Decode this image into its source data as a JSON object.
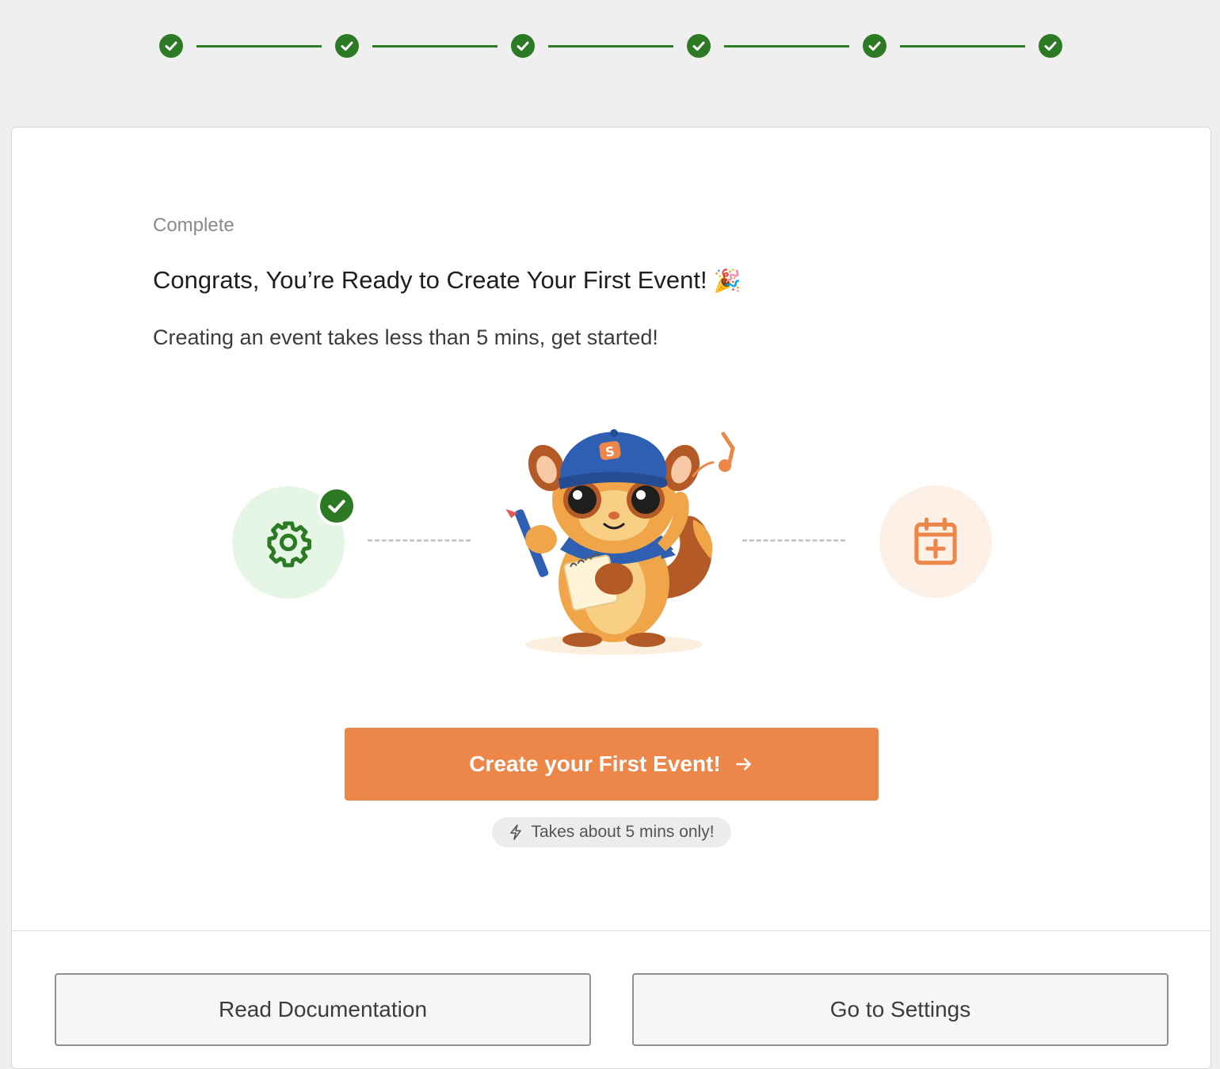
{
  "stepper": {
    "steps": [
      {
        "status": "complete",
        "icon": "check-icon"
      },
      {
        "status": "complete",
        "icon": "check-icon"
      },
      {
        "status": "complete",
        "icon": "check-icon"
      },
      {
        "status": "complete",
        "icon": "check-icon"
      },
      {
        "status": "complete",
        "icon": "check-icon"
      },
      {
        "status": "complete",
        "icon": "check-icon"
      }
    ],
    "color": "#2d7a24"
  },
  "card": {
    "eyebrow": "Complete",
    "headline": "Congrats, You’re Ready to Create Your First Event!",
    "headline_emoji": "🎉",
    "subtitle": "Creating an event takes less than 5 mins, get started!"
  },
  "illustration": {
    "left_icon": "gear-icon",
    "left_badge": "check-icon",
    "center": "mascot-illustration",
    "right_icon": "calendar-plus-icon",
    "colors": {
      "green": "#2d7a24",
      "green_bg": "#e5f7e4",
      "orange": "#ec8649",
      "orange_bg": "#fdf0e7"
    }
  },
  "primary_action": {
    "label": "Create your First Event!",
    "icon": "arrow-right-icon",
    "color": "#ec8649"
  },
  "hint": {
    "icon": "lightning-icon",
    "text": "Takes about 5 mins only!"
  },
  "footer": {
    "read_docs_label": "Read Documentation",
    "settings_label": "Go to Settings"
  }
}
